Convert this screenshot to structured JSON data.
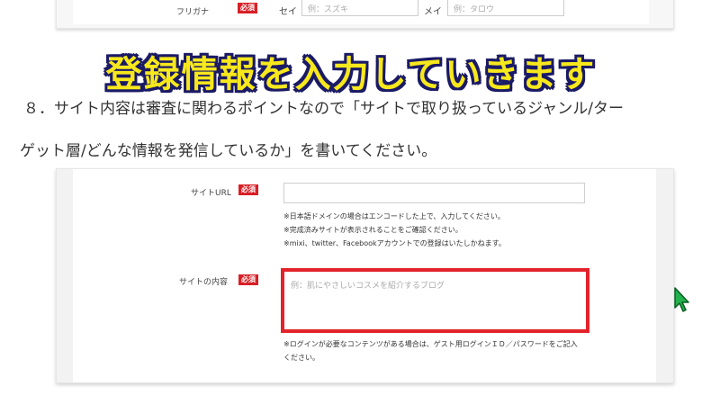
{
  "top_form": {
    "field_label": "フリガナ",
    "required_badge": "必須",
    "sei_label": "セイ",
    "sei_placeholder": "例：スズキ",
    "mei_label": "メイ",
    "mei_placeholder": "例：タロウ"
  },
  "headline": "登録情報を入力していきます",
  "instruction": {
    "line1": "８．サイト内容は審査に関わるポイントなので「サイトで取り扱っているジャンル/ター",
    "line2": "ゲット層/どんな情報を発信しているか」を書いてください。"
  },
  "form": {
    "url_label": "サイトURL",
    "url_required": "必須",
    "url_value": "",
    "url_notes": [
      "※日本語ドメインの場合はエンコードした上で、入力してください。",
      "※完成済みサイトが表示されることをご確認ください。",
      "※mixi、twitter、Facebookアカウントでの登録はいたしかねます。"
    ],
    "content_label": "サイトの内容",
    "content_required": "必須",
    "content_placeholder": "例：肌にやさしいコスメを紹介するブログ",
    "content_notes": [
      "※ログインが必要なコンテンツがある場合は、ゲスト用ログインＩＤ／パスワードをご記入",
      "ください。"
    ]
  },
  "colors": {
    "badge": "#d81f26",
    "highlight_border": "#e3232b",
    "headline_fill": "#f7e81c",
    "cursor": "#22b14c"
  },
  "icons": {
    "cursor": "mouse-pointer-icon"
  }
}
